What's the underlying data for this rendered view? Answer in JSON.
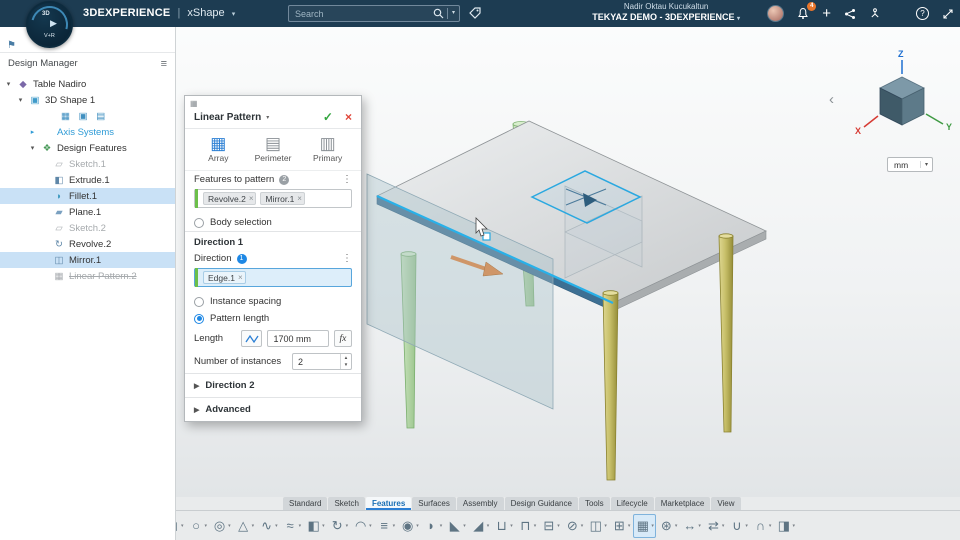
{
  "topbar": {
    "brand": "3DEXPERIENCE",
    "divider": "|",
    "app": "xShape",
    "brand_caret": "▾",
    "search_placeholder": "Search",
    "search_caret": "▾",
    "user_name": "Nadir Oktau Kucukaltun",
    "tenant": "TEKYAZ DEMO - 3DEXPERIENCE",
    "tenant_caret": "▾",
    "notification_count": "4",
    "add_glyph": "+",
    "help_glyph": "?"
  },
  "logo": {
    "line1": "3D",
    "play": "▶",
    "line2": "V+R"
  },
  "sidebar": {
    "panel_title": "Design Manager",
    "menu_glyph": "≡",
    "flag_glyph": "⚑",
    "tree": [
      {
        "name": "tree-item-table-nadiro",
        "label": "Table Nadiro",
        "level": 0,
        "expander": "▾",
        "glyph": "◆",
        "glyph_color": "#7b68a8"
      },
      {
        "name": "tree-item-3d-shape-1",
        "label": "3D Shape 1",
        "level": 1,
        "expander": "▾",
        "glyph": "▣",
        "glyph_color": "#3f9ac9"
      },
      {
        "name": "tree-item-representations",
        "label": "",
        "level": 2,
        "expander": "",
        "glyph": "",
        "badges": "▦ ▣ ▤",
        "style": "badges"
      },
      {
        "name": "tree-item-axis-systems",
        "label": "Axis Systems",
        "level": 2,
        "expander": "▸",
        "glyph": "",
        "style": "link"
      },
      {
        "name": "tree-item-design-features",
        "label": "Design Features",
        "level": 2,
        "expander": "▾",
        "glyph": "❖",
        "glyph_color": "#4a9a5a"
      },
      {
        "name": "tree-item-sketch-1",
        "label": "Sketch.1",
        "level": 3,
        "expander": "",
        "glyph": "▱",
        "glyph_color": "#a8acb0",
        "style": "dim"
      },
      {
        "name": "tree-item-extrude-1",
        "label": "Extrude.1",
        "level": 3,
        "expander": "",
        "glyph": "◧",
        "glyph_color": "#5f87a8"
      },
      {
        "name": "tree-item-fillet-1",
        "label": "Fillet.1",
        "level": 3,
        "expander": "",
        "glyph": "◗",
        "glyph_color": "#3f9ac0",
        "selected": true
      },
      {
        "name": "tree-item-plane-1",
        "label": "Plane.1",
        "level": 3,
        "expander": "",
        "glyph": "▰",
        "glyph_color": "#7aa0c0"
      },
      {
        "name": "tree-item-sketch-2",
        "label": "Sketch.2",
        "level": 3,
        "expander": "",
        "glyph": "▱",
        "glyph_color": "#a8acb0",
        "style": "dim"
      },
      {
        "name": "tree-item-revolve-2",
        "label": "Revolve.2",
        "level": 3,
        "expander": "",
        "glyph": "↻",
        "glyph_color": "#5f87a8"
      },
      {
        "name": "tree-item-mirror-1",
        "label": "Mirror.1",
        "level": 3,
        "expander": "",
        "glyph": "◫",
        "glyph_color": "#5f87a8",
        "selected": true
      },
      {
        "name": "tree-item-linear-pattern-2",
        "label": "Linear Pattern.2",
        "level": 3,
        "expander": "",
        "glyph": "▦",
        "glyph_color": "#a8acb0",
        "style": "strike"
      }
    ]
  },
  "dialog": {
    "grip_glyph": "▦",
    "title": "Linear Pattern",
    "title_caret": "▾",
    "ok_glyph": "✓",
    "cancel_glyph": "×",
    "kebab_glyph": "⋮",
    "chip_close_glyph": "×",
    "modes": [
      {
        "name": "mode-array",
        "label": "Array",
        "glyph": "▦",
        "selected": true
      },
      {
        "name": "mode-perimeter",
        "label": "Perimeter",
        "glyph": "▤"
      },
      {
        "name": "mode-primary",
        "label": "Primary",
        "glyph": "▥"
      }
    ],
    "features_label": "Features to pattern",
    "features_count": "2",
    "feature_chips": [
      {
        "name": "chip-revolve-2",
        "label": "Revolve.2"
      },
      {
        "name": "chip-mirror-1",
        "label": "Mirror.1"
      }
    ],
    "body_selection_label": "Body selection",
    "direction1_title": "Direction 1",
    "direction_label": "Direction",
    "direction_count": "1",
    "direction_chip": "Edge.1",
    "instance_spacing_label": "Instance spacing",
    "pattern_length_label": "Pattern length",
    "length_label": "Length",
    "length_value": "1700 mm",
    "fx_label": "fx",
    "instances_label": "Number of instances",
    "instances_value": "2",
    "stepper_up": "▲",
    "stepper_down": "▼",
    "expand_glyph": "▶",
    "direction2_label": "Direction 2",
    "advanced_label": "Advanced"
  },
  "viewport": {
    "collapse_chevron": "‹",
    "units_value": "mm",
    "units_caret": "▾",
    "axes": {
      "x": "X",
      "y": "Y",
      "z": "Z",
      "x_color": "#d63b34",
      "y_color": "#3f9a43",
      "z_color": "#1e6fd0"
    }
  },
  "tabs": [
    {
      "name": "tab-standard",
      "label": "Standard"
    },
    {
      "name": "tab-sketch",
      "label": "Sketch"
    },
    {
      "name": "tab-features",
      "label": "Features",
      "selected": true
    },
    {
      "name": "tab-surfaces",
      "label": "Surfaces"
    },
    {
      "name": "tab-assembly",
      "label": "Assembly"
    },
    {
      "name": "tab-design-guidance",
      "label": "Design Guidance"
    },
    {
      "name": "tab-tools",
      "label": "Tools"
    },
    {
      "name": "tab-lifecycle",
      "label": "Lifecycle"
    },
    {
      "name": "tab-marketplace",
      "label": "Marketplace"
    },
    {
      "name": "tab-view",
      "label": "View"
    }
  ],
  "toolbar": {
    "tools": [
      {
        "name": "tool-box",
        "glyph": "◻",
        "arrow": "▾"
      },
      {
        "name": "tool-sphere",
        "glyph": "○",
        "arrow": "▾"
      },
      {
        "name": "tool-cylinder",
        "glyph": "◎",
        "arrow": "▾"
      },
      {
        "name": "tool-cone",
        "glyph": "△",
        "arrow": "▾"
      },
      {
        "name": "tool-sweep",
        "glyph": "∿",
        "arrow": "▾"
      },
      {
        "name": "tool-helix",
        "glyph": "≈",
        "arrow": "▾"
      },
      {
        "name": "tool-extrude",
        "glyph": "◧",
        "arrow": "▾"
      },
      {
        "name": "tool-revolve",
        "glyph": "↻",
        "arrow": "▾"
      },
      {
        "name": "tool-loft",
        "glyph": "◠",
        "arrow": "▾"
      },
      {
        "name": "tool-rib",
        "glyph": "≡",
        "arrow": "▾"
      },
      {
        "name": "tool-hole",
        "glyph": "◉",
        "arrow": "▾"
      },
      {
        "name": "tool-fillet",
        "glyph": "◗",
        "arrow": "▾"
      },
      {
        "name": "tool-chamfer",
        "glyph": "◣",
        "arrow": "▾"
      },
      {
        "name": "tool-draft",
        "glyph": "◢",
        "arrow": "▾"
      },
      {
        "name": "tool-shell",
        "glyph": "⊔",
        "arrow": "▾"
      },
      {
        "name": "tool-thickness",
        "glyph": "⊓",
        "arrow": "▾"
      },
      {
        "name": "tool-split",
        "glyph": "⊟",
        "arrow": "▾"
      },
      {
        "name": "tool-trim",
        "glyph": "⊘",
        "arrow": "▾"
      },
      {
        "name": "tool-mirror",
        "glyph": "◫",
        "arrow": "▾"
      },
      {
        "name": "tool-offset",
        "glyph": "⊞",
        "arrow": "▾"
      },
      {
        "name": "tool-linear-pattern",
        "glyph": "▦",
        "arrow": "▾",
        "active": true
      },
      {
        "name": "tool-circular-pattern",
        "glyph": "⊛",
        "arrow": "▾"
      },
      {
        "name": "tool-scale",
        "glyph": "↔",
        "arrow": "▾"
      },
      {
        "name": "tool-move",
        "glyph": "⇄",
        "arrow": "▾"
      },
      {
        "name": "tool-union",
        "glyph": "∪",
        "arrow": "▾"
      },
      {
        "name": "tool-intersect",
        "glyph": "∩",
        "arrow": "▾"
      },
      {
        "name": "tool-convert",
        "glyph": "◨",
        "arrow": "▾"
      }
    ]
  }
}
